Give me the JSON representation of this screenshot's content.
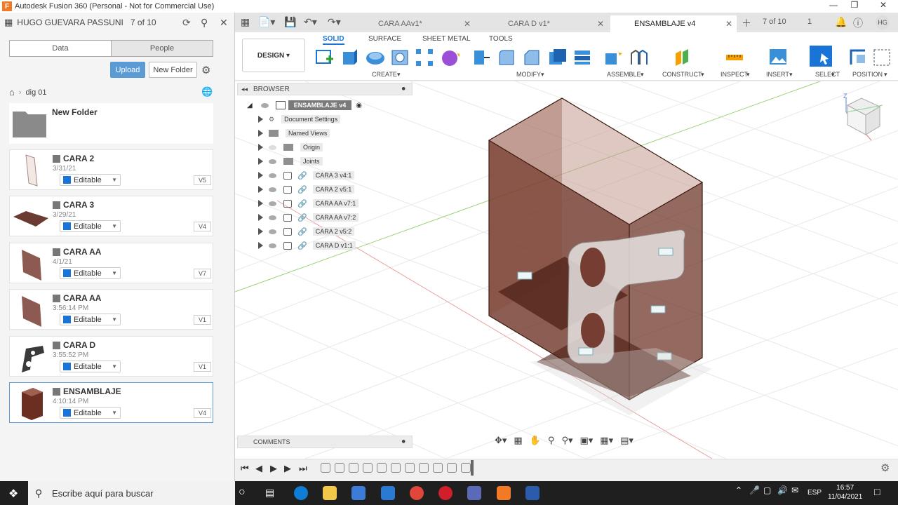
{
  "window": {
    "title": "Autodesk Fusion 360 (Personal - Not for Commercial Use)"
  },
  "datapanel": {
    "user": "HUGO GUEVARA PASSUNI",
    "count": "7 of 10",
    "tabs": [
      "Data",
      "People"
    ],
    "upload_label": "Upload",
    "newfolder_label": "New Folder",
    "breadcrumb": "dig 01",
    "folder": {
      "name": "New Folder"
    },
    "files": [
      {
        "name": "CARA 2",
        "date": "3/31/21",
        "status": "Editable",
        "version": "V5"
      },
      {
        "name": "CARA 3",
        "date": "3/29/21",
        "status": "Editable",
        "version": "V4"
      },
      {
        "name": "CARA AA",
        "date": "4/1/21",
        "status": "Editable",
        "version": "V7"
      },
      {
        "name": "CARA AA",
        "date": "3:56:14 PM",
        "status": "Editable",
        "version": "V1"
      },
      {
        "name": "CARA D",
        "date": "3:55:52 PM",
        "status": "Editable",
        "version": "V1"
      },
      {
        "name": "ENSAMBLAJE",
        "date": "4:10:14 PM",
        "status": "Editable",
        "version": "V4"
      }
    ]
  },
  "doc_tabs": [
    {
      "label": "CARA  AAv1*"
    },
    {
      "label": "CARA D v1*"
    },
    {
      "label": "ENSAMBLAJE v4"
    }
  ],
  "topbar": {
    "count": "7 of 10",
    "jobs": "1",
    "avatar": "HG"
  },
  "ribbon": {
    "workspace": "DESIGN",
    "tabs": [
      "SOLID",
      "SURFACE",
      "SHEET METAL",
      "TOOLS"
    ],
    "groups": [
      "CREATE",
      "MODIFY",
      "ASSEMBLE",
      "CONSTRUCT",
      "INSPECT",
      "INSERT",
      "SELECT",
      "POSITION"
    ]
  },
  "browser": {
    "title": "BROWSER",
    "root": "ENSAMBLAJE v4",
    "items": [
      "Document Settings",
      "Named Views",
      "Origin",
      "Joints",
      "CARA 3 v4:1",
      "CARA 2 v5:1",
      "CARA  AA v7:1",
      "CARA  AA v7:2",
      "CARA 2 v5:2",
      "CARA D v1:1"
    ]
  },
  "comments": {
    "title": "COMMENTS"
  },
  "taskbar": {
    "search_placeholder": "Escribe aquí para buscar",
    "lang": "ESP",
    "time": "16:57",
    "date": "11/04/2021"
  },
  "colors": {
    "accent": "#1a73d6",
    "model": "#6b2f22",
    "upload": "#5b9bd5"
  }
}
